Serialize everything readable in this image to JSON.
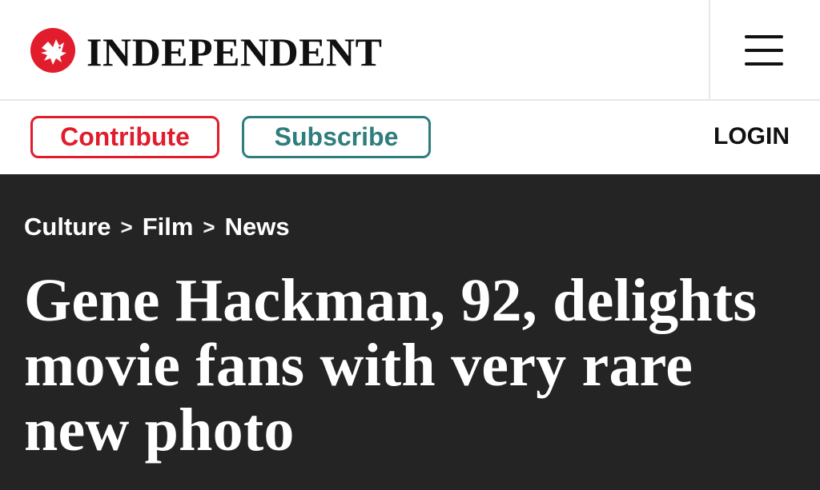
{
  "header": {
    "brand": "INDEPENDENT",
    "logo_icon": "eagle-icon",
    "menu_icon": "hamburger-menu-icon"
  },
  "actions": {
    "contribute_label": "Contribute",
    "subscribe_label": "Subscribe",
    "login_label": "LOGIN"
  },
  "breadcrumb": {
    "items": [
      "Culture",
      "Film",
      "News"
    ],
    "separator": ">"
  },
  "article": {
    "headline": "Gene Hackman, 92, delights movie fans with very rare new photo"
  },
  "colors": {
    "brand_red": "#e11d2d",
    "subscribe_teal": "#2f7d7d",
    "hero_bg": "#242424",
    "text_dark": "#111111",
    "divider": "#e7e7e7"
  }
}
